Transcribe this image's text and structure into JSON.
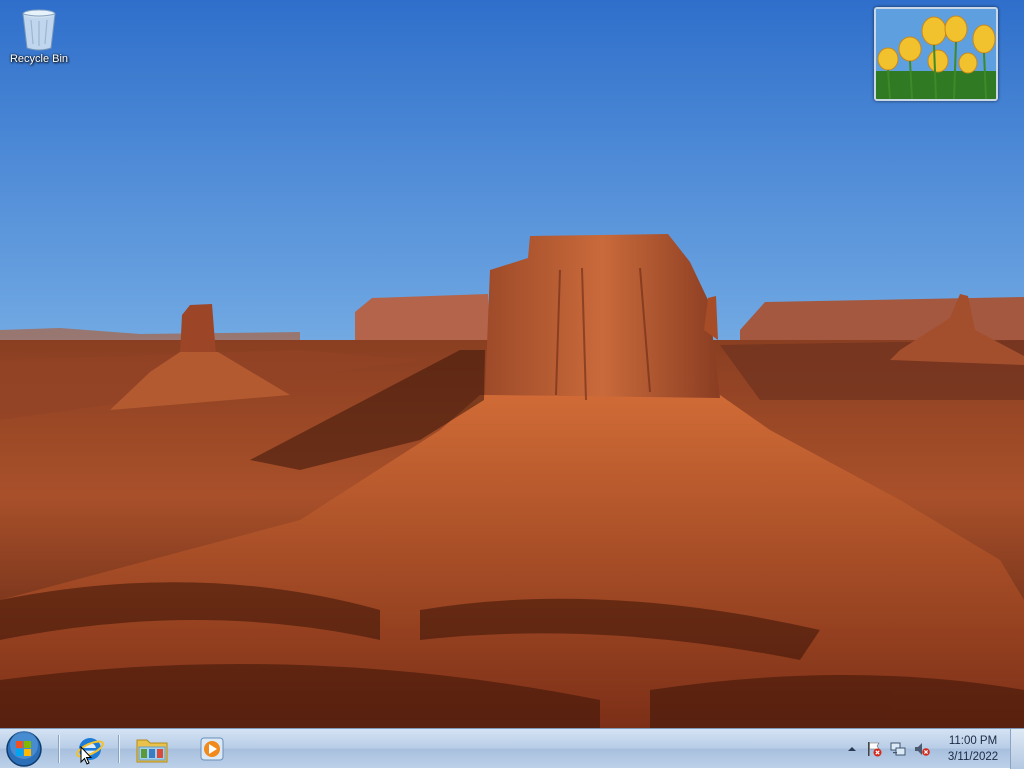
{
  "desktop": {
    "icons": [
      {
        "label": "Recycle Bin",
        "icon": "recycle-bin-icon"
      }
    ],
    "gadget": {
      "kind": "slideshow",
      "icon": "tulips-photo"
    }
  },
  "taskbar": {
    "start": {
      "icon": "windows-orb-icon"
    },
    "pinned": [
      {
        "name": "Internet Explorer",
        "icon": "internet-explorer-icon"
      },
      {
        "name": "Windows Explorer",
        "icon": "folder-icon"
      },
      {
        "name": "Windows Media Player",
        "icon": "media-player-icon"
      }
    ],
    "tray": {
      "icons": [
        "show-hidden-icons-arrow",
        "action-center-flag-icon",
        "network-icon",
        "volume-muted-icon"
      ]
    },
    "clock": {
      "time": "11:00 PM",
      "date": "3/11/2022"
    }
  },
  "colors": {
    "sky_top": "#3a7bd5",
    "sky_bottom": "#c9dff0",
    "rock": "#b6532a",
    "taskbar": "#b8cde6"
  }
}
